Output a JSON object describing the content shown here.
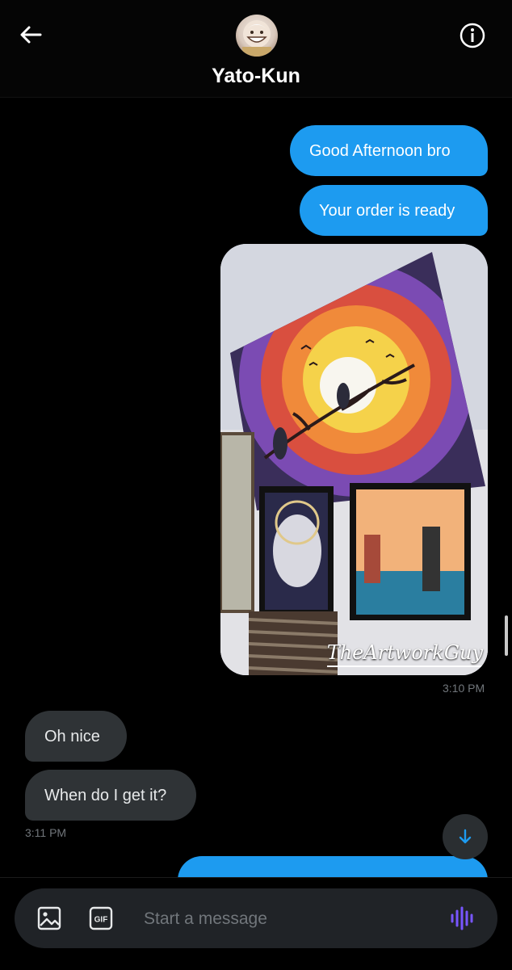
{
  "header": {
    "contact_name": "Yato-Kun",
    "back_icon": "back-arrow-icon",
    "info_icon": "info-icon"
  },
  "messages": [
    {
      "direction": "outgoing",
      "text": "Good Afternoon bro"
    },
    {
      "direction": "outgoing",
      "text": "Your order is ready"
    },
    {
      "direction": "outgoing",
      "type": "image",
      "watermark": "TheArtworkGuy",
      "time": "3:10 PM"
    },
    {
      "direction": "incoming",
      "text": "Oh nice"
    },
    {
      "direction": "incoming",
      "text": "When do I get it?",
      "time": "3:11 PM"
    }
  ],
  "composer": {
    "placeholder": "Start a message",
    "gif_label": "GIF"
  },
  "colors": {
    "outgoing_bubble": "#1d9bf0",
    "incoming_bubble": "#2f3336",
    "voice_icon": "#7856ff"
  }
}
